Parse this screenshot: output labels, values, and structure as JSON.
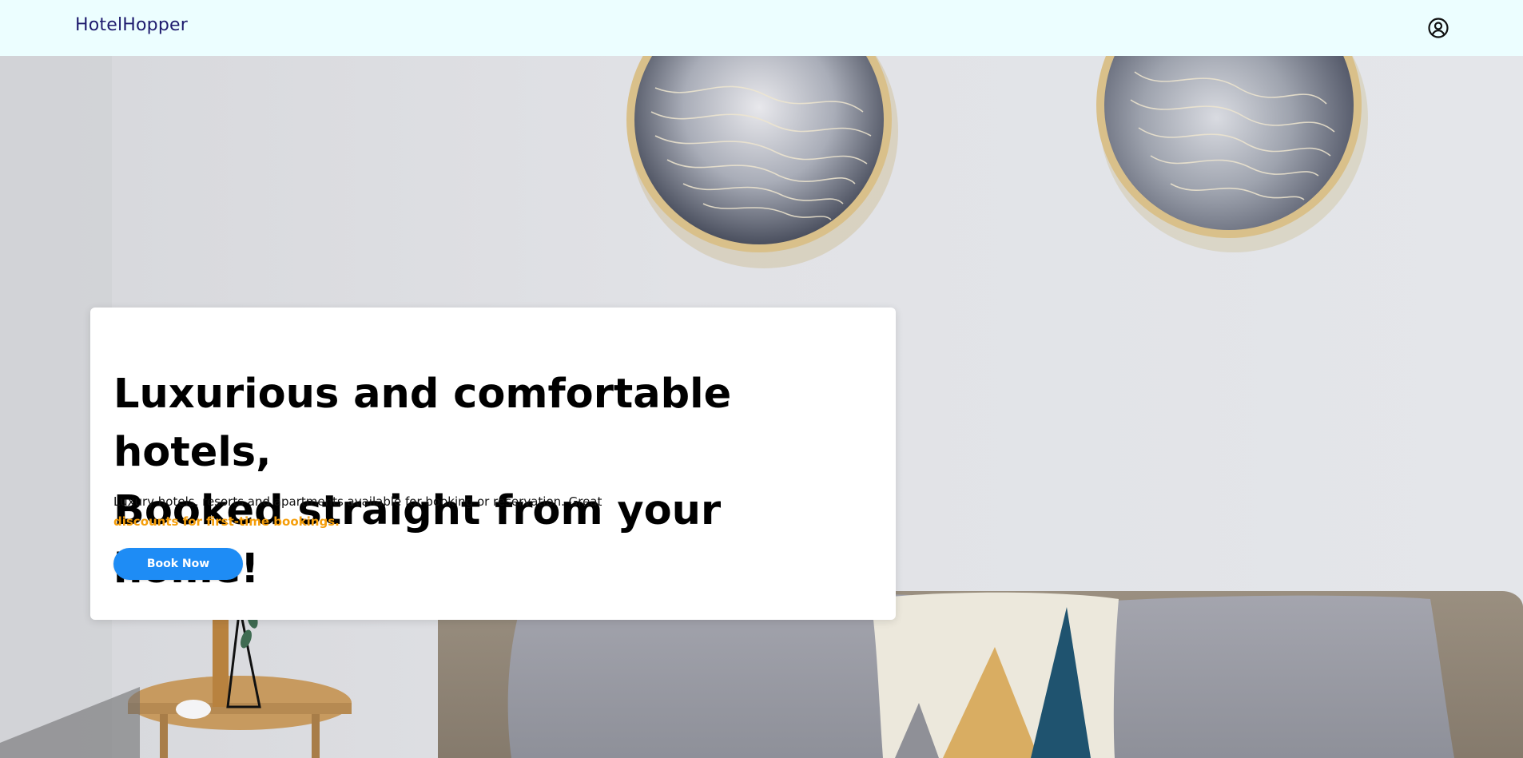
{
  "nav": {
    "brand": "HotelHopper",
    "profile_icon": "user-circle-icon"
  },
  "hero": {
    "headline_line1": "Luxurious and comfortable hotels,",
    "headline_line2": "Booked straight from your home!",
    "subtext_main": "Luxury hotels, resorts and apartments available for booking or reservation. Great",
    "subtext_highlight": "discounts for first-time bookings.",
    "cta_label": "Book Now"
  },
  "colors": {
    "navbar_bg": "#ecfeff",
    "brand": "#1e1b6e",
    "highlight": "#f59e0b",
    "button": "#1e8cf5"
  }
}
